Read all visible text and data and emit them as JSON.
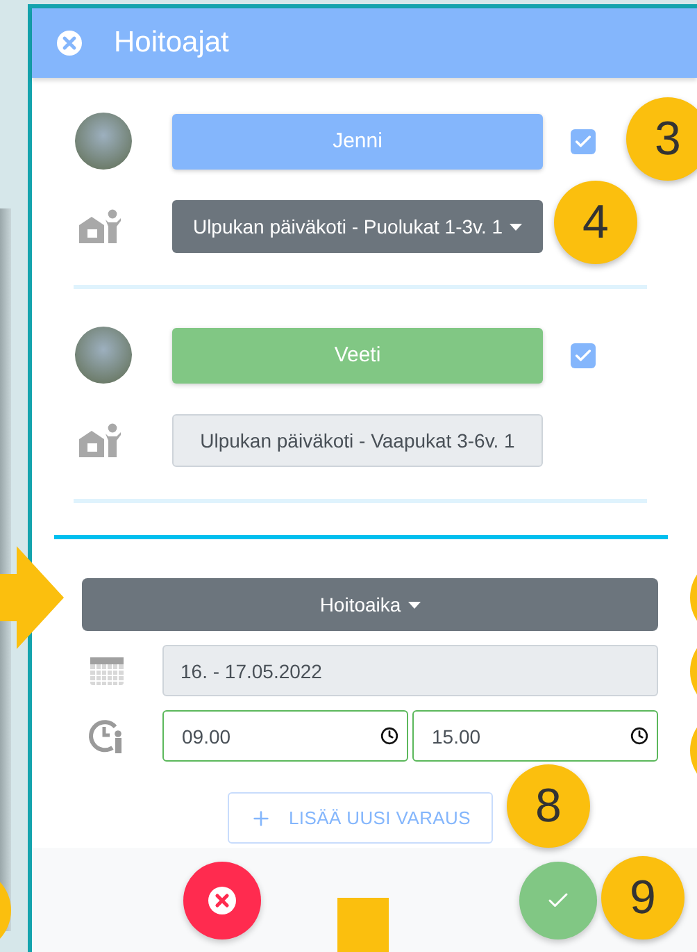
{
  "dialog": {
    "title": "Hoitoajat"
  },
  "children": [
    {
      "name": "Jenni",
      "color": "#84b6fc",
      "checked": true,
      "group": "Ulpukan päiväkoti - Puolukat 1-3v. 1",
      "kind": "dropdown"
    },
    {
      "name": "Veeti",
      "color": "#81c784",
      "checked": true,
      "group": "Ulpukan päiväkoti - Vaapukat 3-6v. 1",
      "kind": "readonly"
    }
  ],
  "care_time": {
    "type_dropdown": "Hoitoaika",
    "date_range": "16. - 17.05.2022",
    "start_time": "09.00",
    "end_time": "15.00",
    "add_button": "LISÄÄ UUSI VARAUS"
  },
  "callouts": [
    {
      "label": "3"
    },
    {
      "label": "4"
    },
    {
      "label": "8"
    },
    {
      "label": "9"
    }
  ]
}
